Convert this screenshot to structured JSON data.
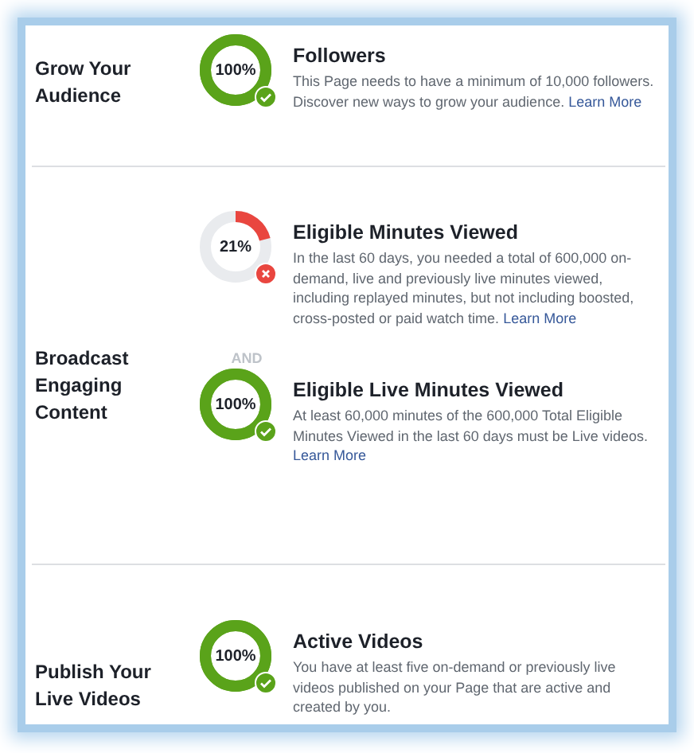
{
  "sections": [
    {
      "title": "Grow Your Audience",
      "requirements": [
        {
          "percent": "100%",
          "met": true,
          "title": "Followers",
          "description": "This Page needs to have a minimum of 10,000 followers. Discover new ways to grow your audience.",
          "link": "Learn More"
        }
      ]
    },
    {
      "title": "Broadcast Engaging Content",
      "joiner": "AND",
      "requirements": [
        {
          "percent": "21%",
          "met": false,
          "title": "Eligible Minutes Viewed",
          "description": "In the last 60 days, you needed a total of 600,000 on-demand, live and previously live minutes viewed, including replayed minutes, but not including boosted, cross-posted or paid watch time.",
          "link": "Learn More"
        },
        {
          "percent": "100%",
          "met": true,
          "title": "Eligible Live Minutes Viewed",
          "description": "At least 60,000 minutes of the 600,000 Total Eligible Minutes Viewed in the last 60 days must be Live videos.",
          "link": "Learn More"
        }
      ]
    },
    {
      "title": "Publish Your Live Videos",
      "requirements": [
        {
          "percent": "100%",
          "met": true,
          "title": "Active Videos",
          "description": "You have at least five on-demand or previously live videos published on your Page that are active and created by you."
        }
      ]
    }
  ]
}
